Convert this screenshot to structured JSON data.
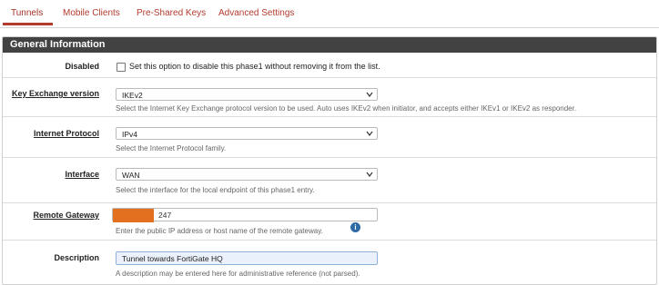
{
  "tabs": [
    {
      "label": "Tunnels",
      "active": true
    },
    {
      "label": "Mobile Clients"
    },
    {
      "label": "Pre-Shared Keys"
    },
    {
      "label": "Advanced Settings"
    }
  ],
  "section": {
    "title": "General Information"
  },
  "fields": {
    "disabled": {
      "label": "Disabled",
      "checkbox_text": "Set this option to disable this phase1 without removing it from the list.",
      "checked": false
    },
    "key_exchange": {
      "label": "Key Exchange version",
      "value": "IKEv2",
      "help": "Select the Internet Key Exchange protocol version to be used. Auto uses IKEv2 when initiator, and accepts either IKEv1 or IKEv2 as responder."
    },
    "internet_protocol": {
      "label": "Internet Protocol",
      "value": "IPv4",
      "help": "Select the Internet Protocol family."
    },
    "interface": {
      "label": "Interface",
      "value": "WAN",
      "help": "Select the interface for the local endpoint of this phase1 entry."
    },
    "remote_gateway": {
      "label": "Remote Gateway",
      "value": "247",
      "help": "Enter the public IP address or host name of the remote gateway."
    },
    "description": {
      "label": "Description",
      "value": "Tunnel towards FortiGate HQ",
      "help": "A description may be entered here for administrative reference (not parsed)."
    }
  },
  "colors": {
    "accent": "#b33a2f",
    "header_bg": "#424242",
    "redaction": "#e2701f",
    "info": "#2f6aa5"
  }
}
